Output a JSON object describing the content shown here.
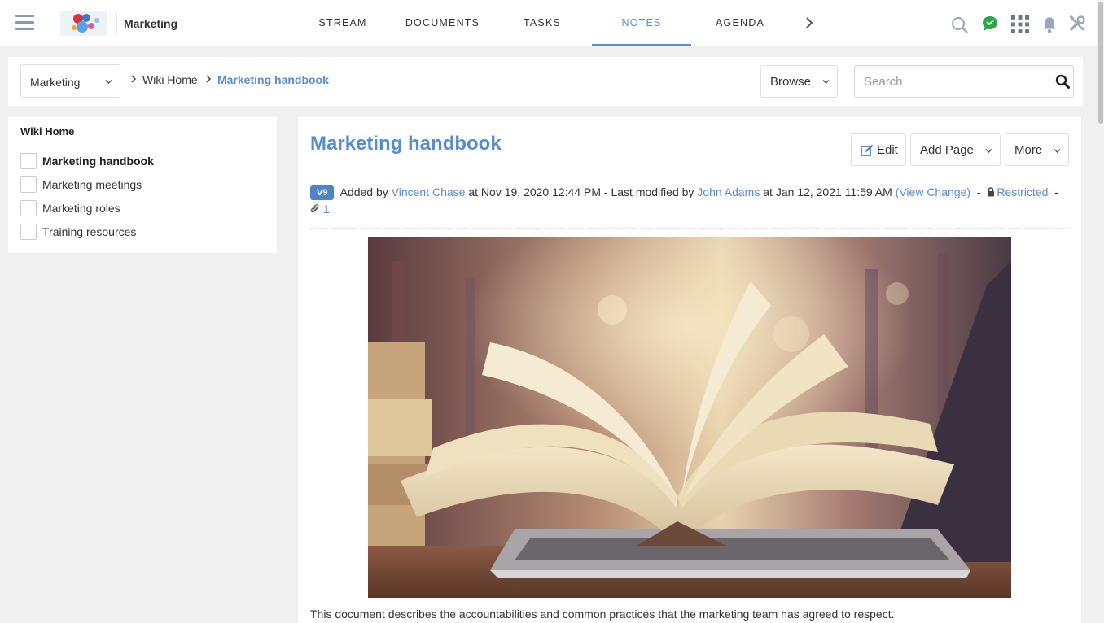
{
  "topbar": {
    "space_name": "Marketing",
    "tabs": [
      {
        "label": "STREAM"
      },
      {
        "label": "DOCUMENTS"
      },
      {
        "label": "TASKS"
      },
      {
        "label": "NOTES",
        "active": true
      },
      {
        "label": "AGENDA"
      }
    ],
    "icons": [
      "menu-icon",
      "search-icon",
      "chat-icon",
      "apps-grid-icon",
      "bell-icon",
      "tools-icon"
    ],
    "chat_color": "#2ea44f"
  },
  "breadcrumb": {
    "space_select": "Marketing",
    "items": [
      "Wiki Home",
      "Marketing handbook"
    ],
    "browse_label": "Browse",
    "search_placeholder": "Search"
  },
  "tree": {
    "title": "Wiki Home",
    "items": [
      {
        "label": "Marketing handbook",
        "active": true
      },
      {
        "label": "Marketing meetings"
      },
      {
        "label": "Marketing roles"
      },
      {
        "label": "Training resources"
      }
    ]
  },
  "page": {
    "title": "Marketing handbook",
    "actions": {
      "edit": "Edit",
      "add_page": "Add Page",
      "more": "More"
    },
    "meta": {
      "version": "V9",
      "added_by_prefix": "Added by",
      "author": "Vincent Chase",
      "added_at": "at Nov 19, 2020 12:44 PM - Last modified by",
      "modifier": "John Adams",
      "modified_at": "at Jan 12, 2021 11:59 AM",
      "view_change": "(View Change)",
      "dash1": "-",
      "restricted": "Restricted",
      "dash2": "-",
      "attachments": "1"
    },
    "body_text": "This document describes the accountabilities and common practices that the marketing team has agreed to respect."
  },
  "colors": {
    "accent": "#578dc9",
    "badge": "#4e85c5"
  }
}
